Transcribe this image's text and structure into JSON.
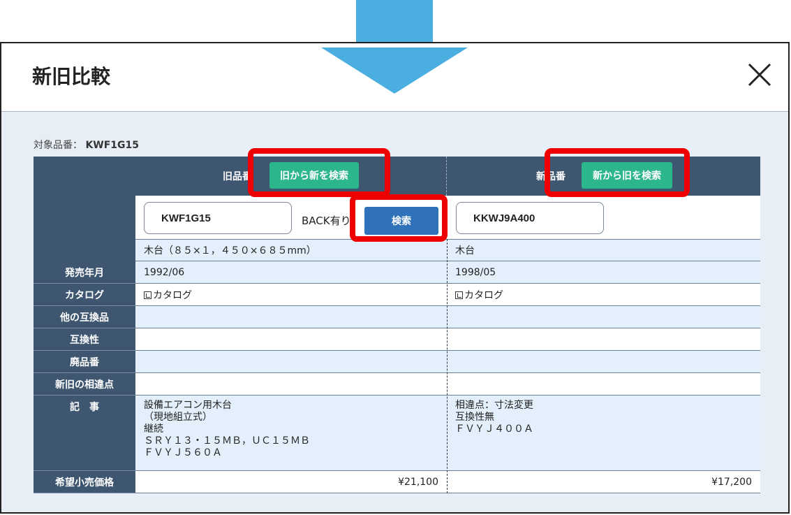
{
  "dialog": {
    "title": "新旧比較"
  },
  "target": {
    "label": "対象品番：",
    "value": "KWF1G15"
  },
  "old_column": {
    "header_left": "旧品番",
    "search_new_button": "旧から新を検索",
    "input_value": "KWF1G15",
    "back_text": "BACK有り",
    "search_button": "検索",
    "description": "木台（８５×１，４５０×６８５mm）"
  },
  "new_column": {
    "header_left": "新品番",
    "search_old_button": "新から旧を検索",
    "input_value": "KKWJ9A400",
    "description": "木台"
  },
  "rows": {
    "release": {
      "label": "発売年月",
      "old": "1992/06",
      "new": "1998/05"
    },
    "catalog": {
      "label": "カタログ",
      "old": "カタログ",
      "new": "カタログ"
    },
    "other_compatible": {
      "label": "他の互換品",
      "old": "",
      "new": ""
    },
    "compatibility": {
      "label": "互換性",
      "old": "",
      "new": ""
    },
    "discontinued": {
      "label": "廃品番",
      "old": "",
      "new": ""
    },
    "differences": {
      "label": "新旧の相違点",
      "old": "",
      "new": ""
    },
    "article": {
      "label": "記　事",
      "old": [
        "設備エアコン用木台",
        "（現地組立式）",
        "継続",
        "ＳＲＹ１３・１５ＭＢ，ＵＣ１５ＭＢ",
        "ＦＶＹＪ５６０Ａ"
      ],
      "new": [
        "相違点：寸法変更",
        "互換性無",
        "ＦＶＹＪ４００Ａ"
      ]
    },
    "price": {
      "label": "希望小売価格",
      "old": "¥21,100",
      "new": "¥17,200"
    }
  },
  "icons": {
    "close": "close-icon",
    "catalog": "pdf-icon",
    "arrow": "down-arrow-graphic"
  },
  "colors": {
    "header_bg": "#3e5670",
    "green_button": "#2db58c",
    "blue_button": "#2f72b9",
    "highlight": "#ee0000",
    "arrow": "#4aaee0"
  }
}
